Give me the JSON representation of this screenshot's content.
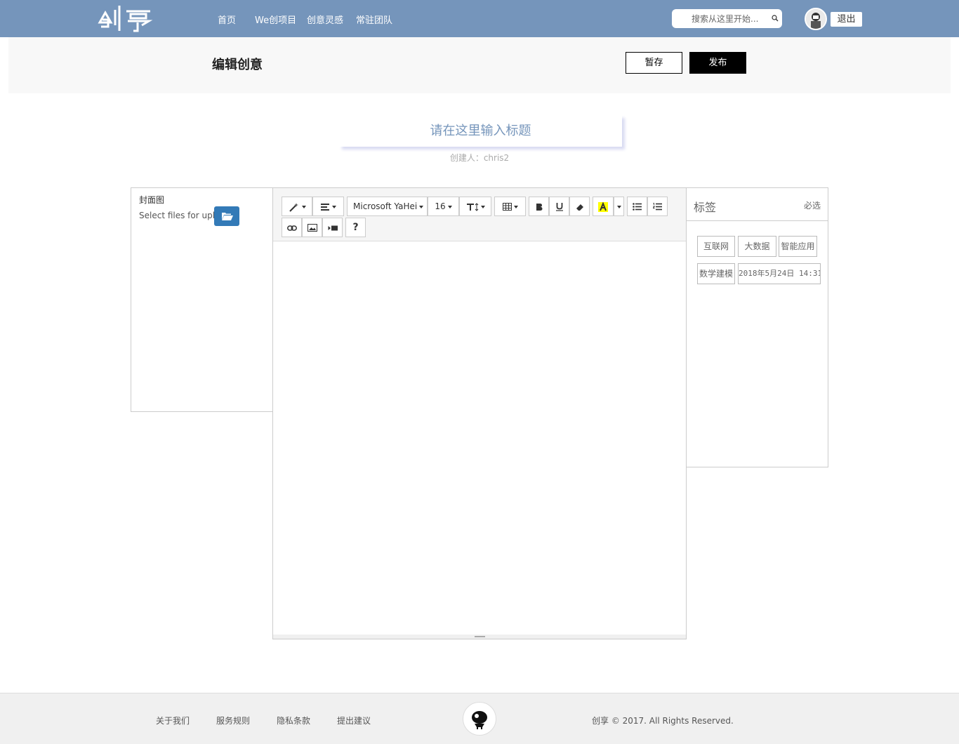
{
  "header": {
    "logo_text": "创享",
    "nav": [
      "首页",
      "We创项目",
      "创意灵感",
      "常驻团队"
    ],
    "search_placeholder": "搜索从这里开始...",
    "logout_label": "退出"
  },
  "subbar": {
    "title": "编辑创意",
    "save_label": "暂存",
    "publish_label": "发布"
  },
  "form": {
    "title_placeholder": "请在这里输入标题",
    "creator": "创建人：chris2"
  },
  "cover": {
    "label": "封面图",
    "upload_text": "Select files for upload..."
  },
  "toolbar": {
    "font_name": "Microsoft YaHei",
    "font_size": "16",
    "help_label": "?"
  },
  "tags": {
    "title": "标签",
    "required_label": "必选",
    "items": [
      "互联网",
      "大数据",
      "智能应用",
      "数学建模",
      "2018年5月24日 14:31"
    ]
  },
  "footer": {
    "links": [
      "关于我们",
      "服务规则",
      "隐私条款",
      "提出建议"
    ],
    "copyright": "创享 © 2017. All Rights Reserved."
  },
  "colors": {
    "header_bg": "#7595bb",
    "primary_button": "#337ab7",
    "publish_bg": "#000000"
  }
}
